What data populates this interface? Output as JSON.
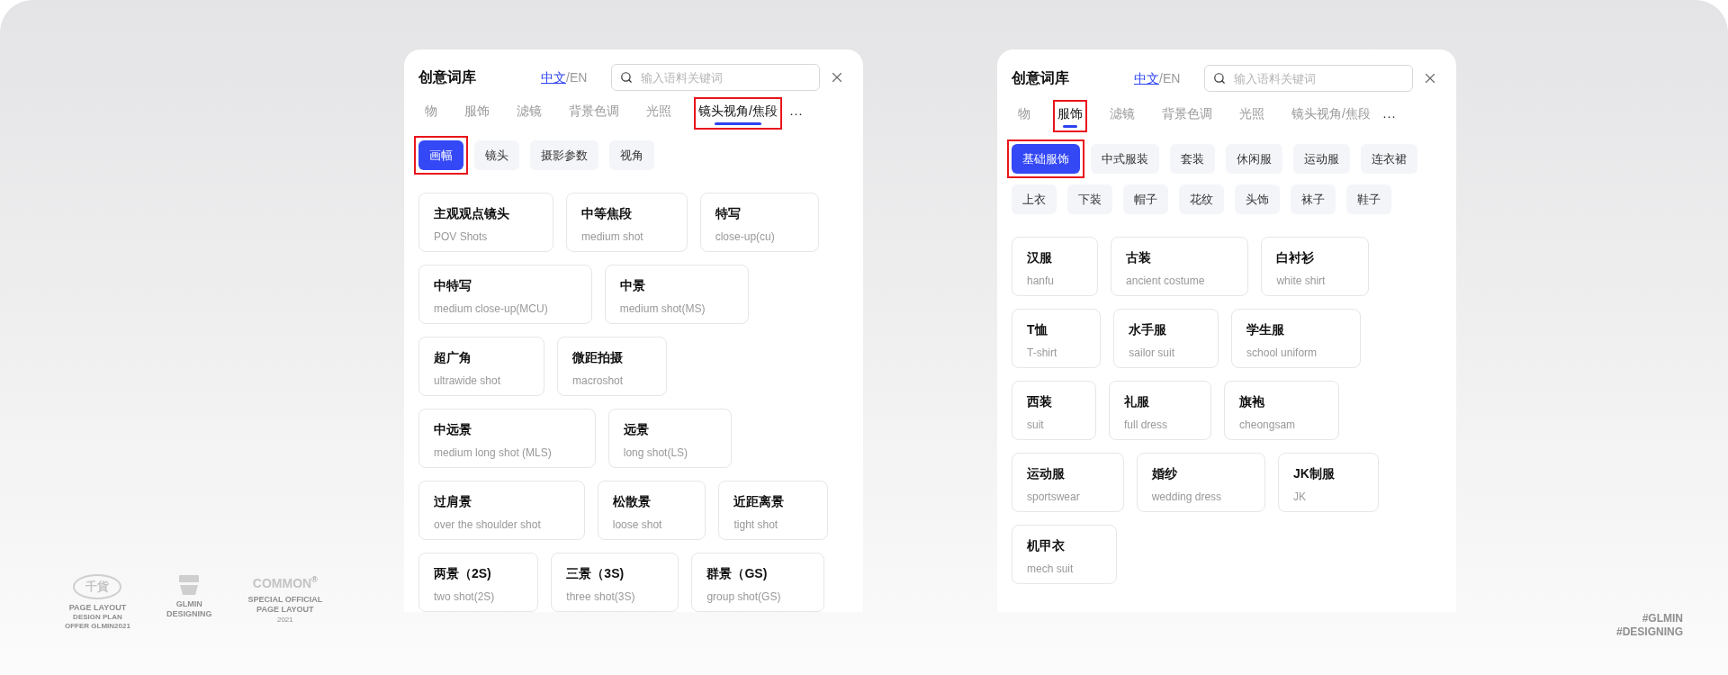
{
  "panels": [
    {
      "title": "创意词库",
      "languages": [
        {
          "label": "中文",
          "selected": true
        },
        {
          "label": "EN",
          "selected": false
        }
      ],
      "language_separator": "/",
      "search": {
        "placeholder": "输入语料关键词"
      },
      "tabs": [
        {
          "label": "物",
          "selected": false,
          "annotated": false
        },
        {
          "label": "服饰",
          "selected": false,
          "annotated": false
        },
        {
          "label": "滤镜",
          "selected": false,
          "annotated": false
        },
        {
          "label": "背景色调",
          "selected": false,
          "annotated": false
        },
        {
          "label": "光照",
          "selected": false,
          "annotated": false
        },
        {
          "label": "镜头视角/焦段",
          "selected": true,
          "annotated": true
        }
      ],
      "more": "···",
      "chips": [
        {
          "label": "画幅",
          "selected": true,
          "annotated": true
        },
        {
          "label": "镜头",
          "selected": false,
          "annotated": false
        },
        {
          "label": "摄影参数",
          "selected": false,
          "annotated": false
        },
        {
          "label": "视角",
          "selected": false,
          "annotated": false
        }
      ],
      "cards": [
        [
          {
            "title": "主观观点镜头",
            "subtitle": "POV Shots"
          },
          {
            "title": "中等焦段",
            "subtitle": "medium shot"
          },
          {
            "title": "特写",
            "subtitle": "close-up(cu)"
          }
        ],
        [
          {
            "title": "中特写",
            "subtitle": "medium close-up(MCU)"
          },
          {
            "title": "中景",
            "subtitle": "medium shot(MS)"
          }
        ],
        [
          {
            "title": "超广角",
            "subtitle": "ultrawide shot"
          },
          {
            "title": "微距拍摄",
            "subtitle": "macroshot"
          }
        ],
        [
          {
            "title": "中远景",
            "subtitle": "medium long shot (MLS)"
          },
          {
            "title": "远景",
            "subtitle": "long shot(LS)"
          }
        ],
        [
          {
            "title": "过肩景",
            "subtitle": "over the shoulder shot"
          },
          {
            "title": "松散景",
            "subtitle": "loose shot"
          },
          {
            "title": "近距离景",
            "subtitle": "tight shot"
          }
        ],
        [
          {
            "title": "两景（2S)",
            "subtitle": "two shot(2S)"
          },
          {
            "title": "三景（3S)",
            "subtitle": "three shot(3S)"
          },
          {
            "title": "群景（GS)",
            "subtitle": "group shot(GS)"
          }
        ]
      ]
    },
    {
      "title": "创意词库",
      "languages": [
        {
          "label": "中文",
          "selected": true
        },
        {
          "label": "EN",
          "selected": false
        }
      ],
      "language_separator": "/",
      "search": {
        "placeholder": "输入语料关键词"
      },
      "tabs": [
        {
          "label": "物",
          "selected": false,
          "annotated": false
        },
        {
          "label": "服饰",
          "selected": true,
          "annotated": true
        },
        {
          "label": "滤镜",
          "selected": false,
          "annotated": false
        },
        {
          "label": "背景色调",
          "selected": false,
          "annotated": false
        },
        {
          "label": "光照",
          "selected": false,
          "annotated": false
        },
        {
          "label": "镜头视角/焦段",
          "selected": false,
          "annotated": false
        }
      ],
      "more": "···",
      "chips": [
        {
          "label": "基础服饰",
          "selected": true,
          "annotated": true
        },
        {
          "label": "中式服装",
          "selected": false,
          "annotated": false
        },
        {
          "label": "套装",
          "selected": false,
          "annotated": false
        },
        {
          "label": "休闲服",
          "selected": false,
          "annotated": false
        },
        {
          "label": "运动服",
          "selected": false,
          "annotated": false
        },
        {
          "label": "连衣裙",
          "selected": false,
          "annotated": false
        },
        {
          "label": "上衣",
          "selected": false,
          "annotated": false
        },
        {
          "label": "下装",
          "selected": false,
          "annotated": false
        },
        {
          "label": "帽子",
          "selected": false,
          "annotated": false
        },
        {
          "label": "花纹",
          "selected": false,
          "annotated": false
        },
        {
          "label": "头饰",
          "selected": false,
          "annotated": false
        },
        {
          "label": "袜子",
          "selected": false,
          "annotated": false
        },
        {
          "label": "鞋子",
          "selected": false,
          "annotated": false
        }
      ],
      "cards": [
        [
          {
            "title": "汉服",
            "subtitle": "hanfu"
          },
          {
            "title": "古装",
            "subtitle": "ancient costume"
          },
          {
            "title": "白衬衫",
            "subtitle": "white shirt"
          }
        ],
        [
          {
            "title": "T恤",
            "subtitle": "T-shirt"
          },
          {
            "title": "水手服",
            "subtitle": "sailor suit"
          },
          {
            "title": "学生服",
            "subtitle": "school uniform"
          }
        ],
        [
          {
            "title": "西装",
            "subtitle": "suit"
          },
          {
            "title": "礼服",
            "subtitle": "full dress"
          },
          {
            "title": "旗袍",
            "subtitle": "cheongsam"
          }
        ],
        [
          {
            "title": "运动服",
            "subtitle": "sportswear"
          },
          {
            "title": "婚纱",
            "subtitle": "wedding dress"
          },
          {
            "title": "JK制服",
            "subtitle": "JK"
          }
        ],
        [
          {
            "title": "机甲衣",
            "subtitle": "mech suit"
          }
        ]
      ]
    }
  ],
  "branding": {
    "logos": [
      {
        "kind": "badge",
        "mark": "千貨",
        "lines": [
          "PAGE LAYOUT",
          "DESIGN PLAN",
          "OFFER GLMIN2021"
        ]
      },
      {
        "kind": "crest",
        "lines": [
          "GLMIN",
          "DESIGNING"
        ]
      },
      {
        "kind": "wordmark",
        "mark": "COMMON",
        "superscript": "®",
        "lines": [
          "SPECIAL OFFICIAL",
          "PAGE LAYOUT",
          "2021"
        ]
      }
    ],
    "tags": [
      "#GLMIN",
      "#DESIGNING"
    ]
  }
}
